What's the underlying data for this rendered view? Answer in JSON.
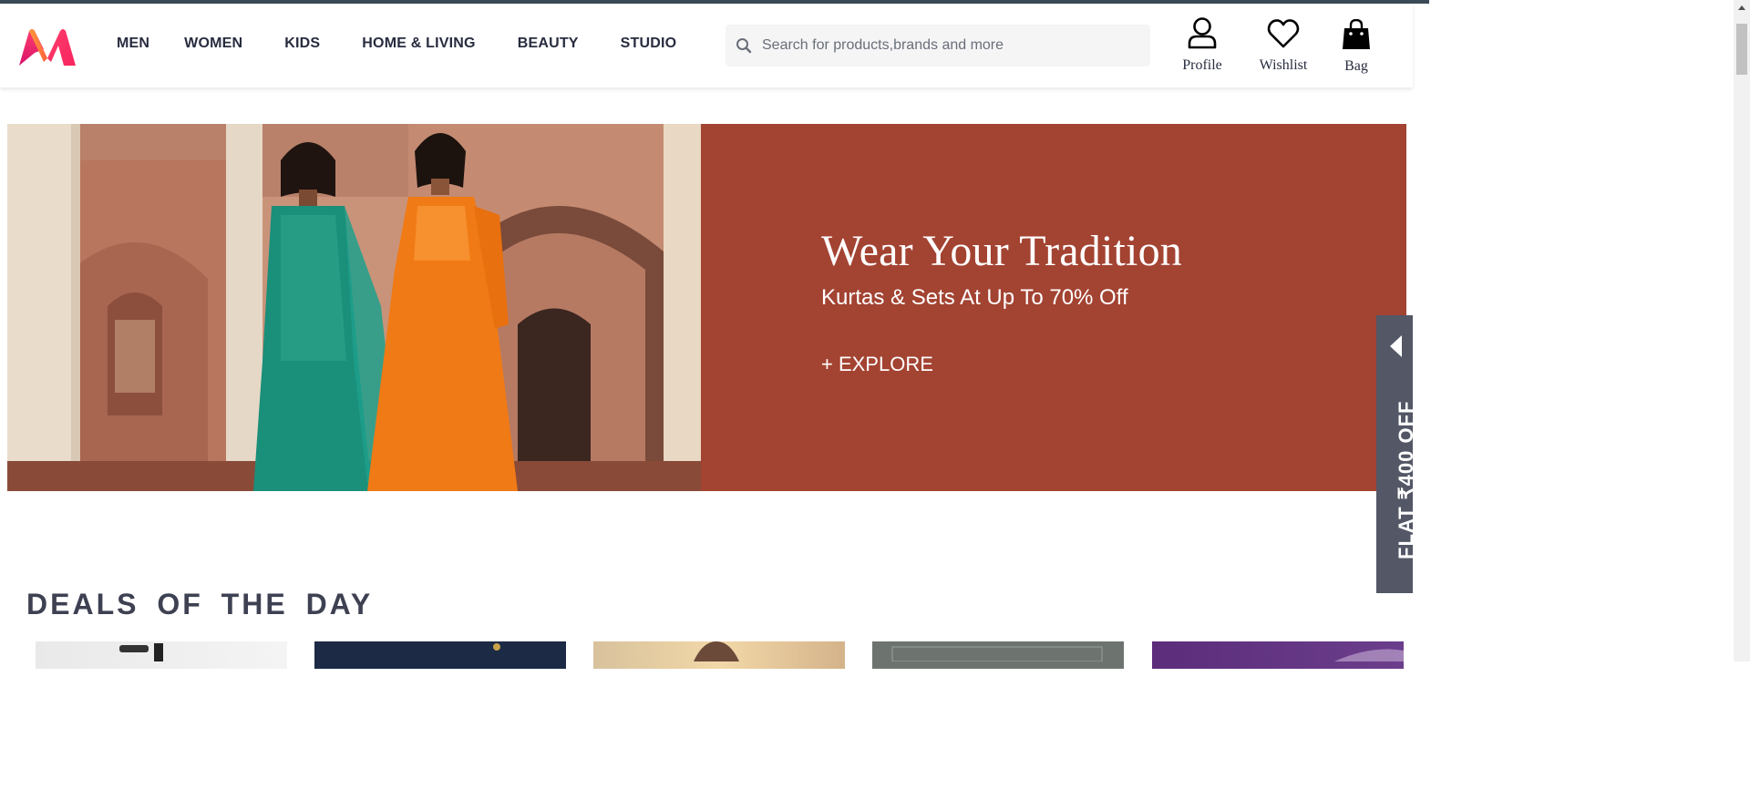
{
  "header": {
    "logo": "myntra-logo",
    "menu": [
      {
        "label": "MEN"
      },
      {
        "label": "WOMEN"
      },
      {
        "label": "KIDS"
      },
      {
        "label": "HOME & LIVING"
      },
      {
        "label": "BEAUTY"
      },
      {
        "label": "STUDIO"
      }
    ],
    "search": {
      "placeholder": "Search for products,brands and more",
      "value": ""
    },
    "actions": {
      "profile": "Profile",
      "wishlist": "Wishlist",
      "bag": "Bag"
    }
  },
  "banner": {
    "title": "Wear Your Tradition",
    "subtitle": "Kurtas & Sets At Up To 70% Off",
    "cta": "+ EXPLORE",
    "bg_color": "#a34332"
  },
  "side_promo": {
    "label": "FLAT ₹400 OFF"
  },
  "deals": {
    "title": "DEALS OF THE DAY"
  },
  "colors": {
    "nav_text": "#282c3f",
    "search_bg": "#f5f5f6",
    "promo_bg": "#535766"
  }
}
